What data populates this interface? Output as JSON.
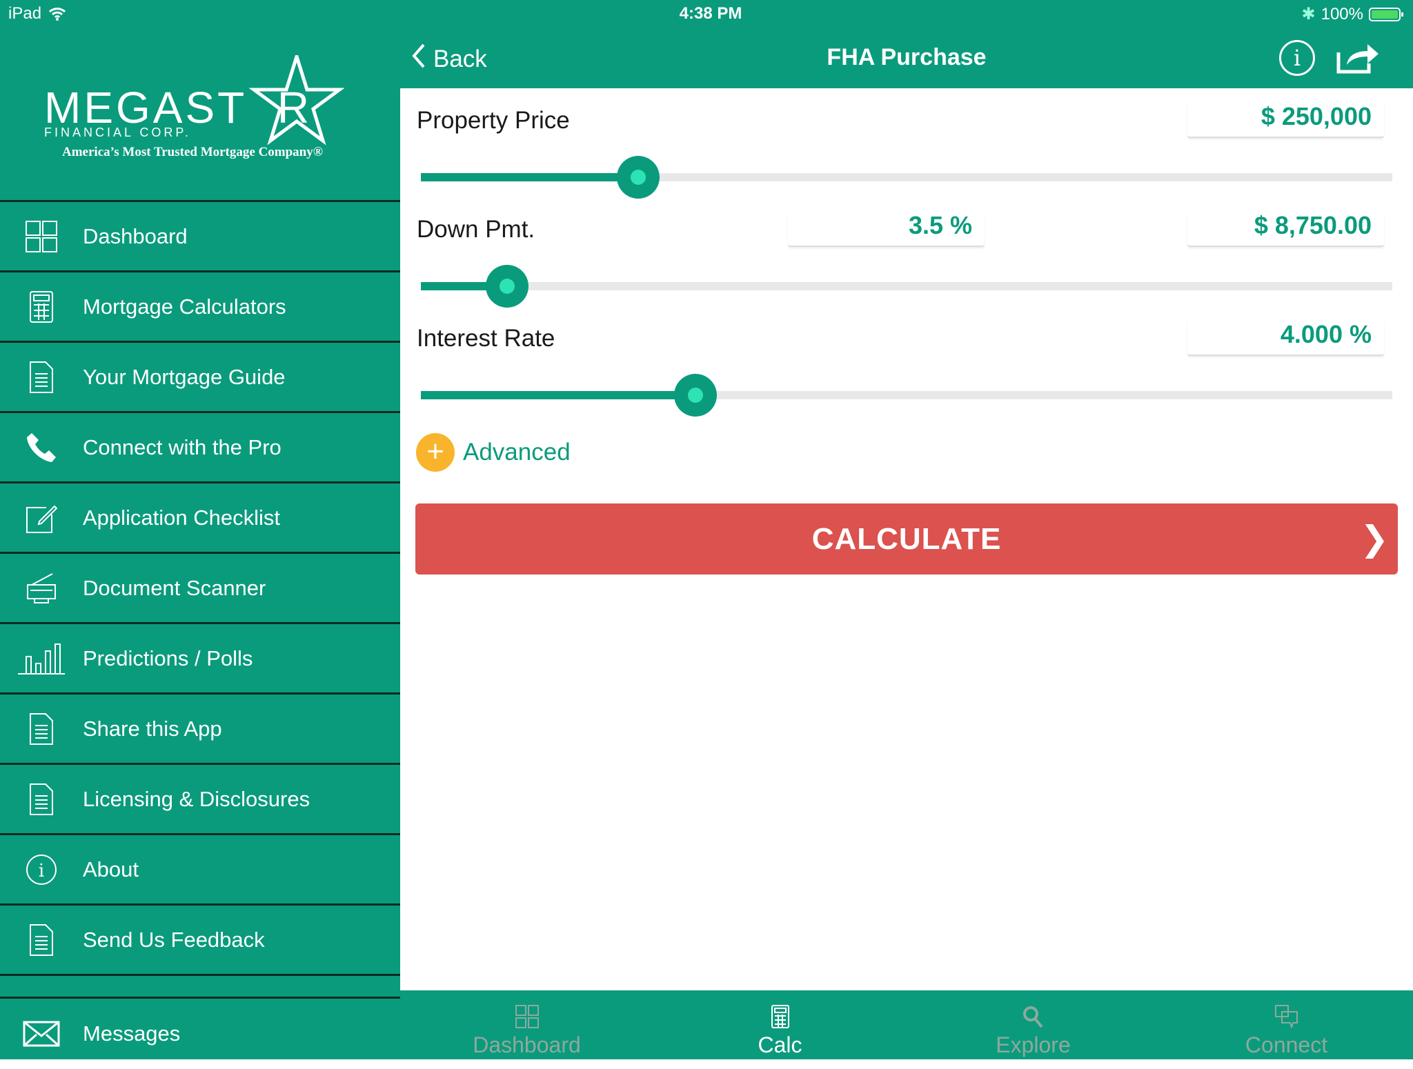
{
  "status_bar": {
    "device": "iPad",
    "time": "4:38 PM",
    "battery": "100%"
  },
  "logo": {
    "name": "MEGASTAR",
    "sub": "FINANCIAL CORP.",
    "tagline": "America’s Most Trusted Mortgage Company®"
  },
  "sidebar": {
    "items": [
      {
        "label": "Dashboard",
        "icon": "grid-icon"
      },
      {
        "label": "Mortgage Calculators",
        "icon": "calculator-icon"
      },
      {
        "label": "Your Mortgage Guide",
        "icon": "document-icon"
      },
      {
        "label": "Connect with the Pro",
        "icon": "phone-icon"
      },
      {
        "label": "Application Checklist",
        "icon": "edit-icon"
      },
      {
        "label": "Document Scanner",
        "icon": "scanner-icon"
      },
      {
        "label": "Predictions / Polls",
        "icon": "bar-chart-icon"
      },
      {
        "label": "Share this App",
        "icon": "document-icon"
      },
      {
        "label": "Licensing & Disclosures",
        "icon": "document-icon"
      },
      {
        "label": "About",
        "icon": "info-icon"
      },
      {
        "label": "Send Us Feedback",
        "icon": "document-icon"
      }
    ],
    "messages": {
      "label": "Messages",
      "icon": "envelope-icon"
    }
  },
  "header": {
    "back": "Back",
    "title": "FHA Purchase"
  },
  "form": {
    "property_price": {
      "label": "Property Price",
      "value": "$ 250,000",
      "slider": 0.224
    },
    "down_payment": {
      "label": "Down Pmt.",
      "percent": "3.5 %",
      "value": "$ 8,750.00",
      "slider": 0.089
    },
    "interest_rate": {
      "label": "Interest Rate",
      "value": "4.000 %",
      "slider": 0.283
    },
    "advanced": "Advanced",
    "calculate": "CALCULATE"
  },
  "tabs": [
    {
      "label": "Dashboard",
      "active": false
    },
    {
      "label": "Calc",
      "active": true
    },
    {
      "label": "Explore",
      "active": false
    },
    {
      "label": "Connect",
      "active": false
    }
  ],
  "colors": {
    "primary": "#0a9b7c",
    "calculate": "#db524e",
    "advanced": "#f9b42c"
  }
}
